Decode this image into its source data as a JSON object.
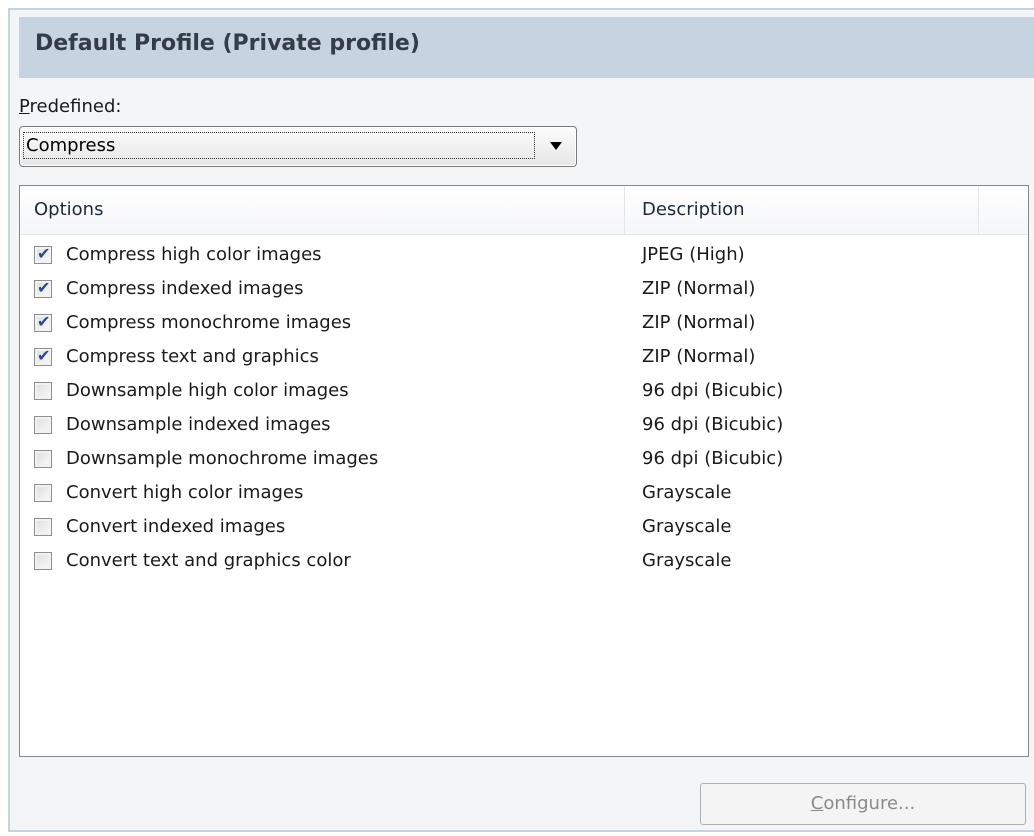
{
  "header": {
    "title": "Default Profile (Private profile)"
  },
  "predefined": {
    "label_accel": "P",
    "label_rest": "redefined:",
    "selected": "Compress"
  },
  "table": {
    "columns": {
      "options": "Options",
      "description": "Description"
    },
    "rows": [
      {
        "checked": true,
        "option": "Compress high color images",
        "description": "JPEG (High)"
      },
      {
        "checked": true,
        "option": "Compress indexed images",
        "description": "ZIP (Normal)"
      },
      {
        "checked": true,
        "option": "Compress monochrome images",
        "description": "ZIP (Normal)"
      },
      {
        "checked": true,
        "option": "Compress text and graphics",
        "description": "ZIP (Normal)"
      },
      {
        "checked": false,
        "option": "Downsample high color images",
        "description": "96 dpi (Bicubic)"
      },
      {
        "checked": false,
        "option": "Downsample indexed images",
        "description": "96 dpi (Bicubic)"
      },
      {
        "checked": false,
        "option": "Downsample monochrome images",
        "description": "96 dpi (Bicubic)"
      },
      {
        "checked": false,
        "option": "Convert high color images",
        "description": "Grayscale"
      },
      {
        "checked": false,
        "option": "Convert indexed images",
        "description": "Grayscale"
      },
      {
        "checked": false,
        "option": "Convert text and graphics color",
        "description": "Grayscale"
      }
    ]
  },
  "configure_button": {
    "accel": "C",
    "rest": "onfigure...",
    "enabled": false
  },
  "colors": {
    "header_bg": "#c6d3e0",
    "header_text": "#333c48",
    "checkmark": "#2b4a8a"
  }
}
